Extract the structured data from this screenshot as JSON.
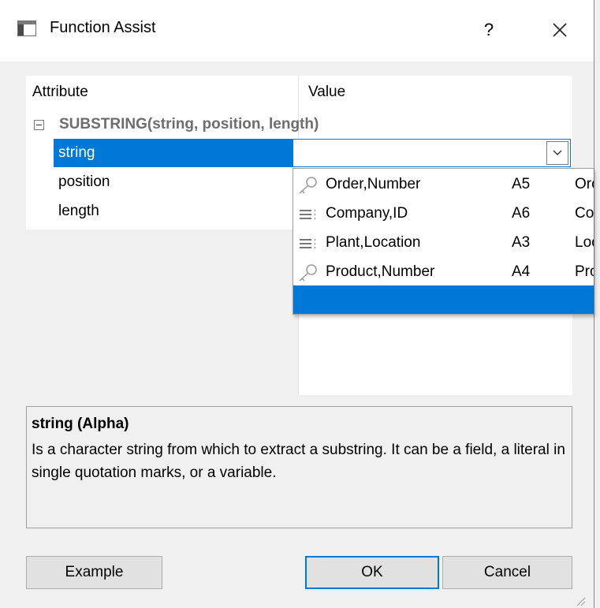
{
  "window": {
    "title": "Function Assist",
    "help_label": "?",
    "close_icon": "close-icon"
  },
  "grid": {
    "attribute_header": "Attribute",
    "value_header": "Value",
    "group_label": "SUBSTRING(string, position, length)",
    "rows": [
      {
        "label": "string",
        "selected": true
      },
      {
        "label": "position",
        "selected": false
      },
      {
        "label": "length",
        "selected": false
      }
    ],
    "combo_value": ""
  },
  "dropdown": {
    "items": [
      {
        "name": "Order,Number",
        "format": "A5",
        "alias": "Orc",
        "icon": "key-icon"
      },
      {
        "name": "Company,ID",
        "format": "A6",
        "alias": "Co",
        "icon": "field-list-icon"
      },
      {
        "name": "Plant,Location",
        "format": "A3",
        "alias": "Loc",
        "icon": "field-list-icon"
      },
      {
        "name": "Product,Number",
        "format": "A4",
        "alias": "Pro",
        "icon": "key-icon"
      }
    ]
  },
  "description": {
    "title": "string (Alpha)",
    "body": "Is a character string from which to extract a substring. It can be a field, a literal in single quotation marks, or a variable."
  },
  "buttons": {
    "example": "Example",
    "ok": "OK",
    "cancel": "Cancel"
  },
  "colors": {
    "accent": "#0078d7",
    "background": "#f0f0f0"
  }
}
